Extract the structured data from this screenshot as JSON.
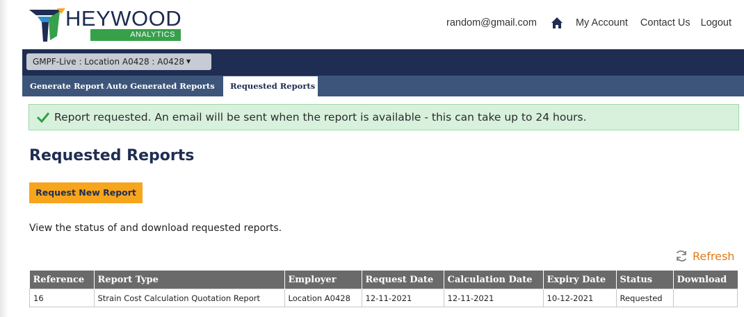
{
  "header": {
    "logo_text": "HEYWOOD",
    "logo_sub": "ANALYTICS",
    "user_email": "random@gmail.com",
    "home_icon": "home-icon",
    "links": [
      "My Account",
      "Contact Us",
      "Logout"
    ]
  },
  "location_selector": {
    "value": "GMPF-Live : Location A0428 : A0428"
  },
  "tabs": [
    {
      "label": "Generate Report",
      "active": false
    },
    {
      "label": "Auto Generated Reports",
      "active": false
    },
    {
      "label": "Requested Reports",
      "active": true
    }
  ],
  "alert": {
    "icon": "check-icon",
    "message": "Report requested. An email will be sent when the report is available - this can take up to 24 hours."
  },
  "page": {
    "title": "Requested Reports",
    "request_button": "Request New Report",
    "description": "View the status of and download requested reports.",
    "refresh_label": "Refresh"
  },
  "table": {
    "columns": [
      "Reference",
      "Report Type",
      "Employer",
      "Request Date",
      "Calculation Date",
      "Expiry Date",
      "Status",
      "Download"
    ],
    "rows": [
      [
        "16",
        "Strain Cost Calculation Quotation Report",
        "Location A0428",
        "12-11-2021",
        "12-11-2021",
        "10-12-2021",
        "Requested",
        ""
      ]
    ]
  },
  "colors": {
    "navy": "#1f2d52",
    "tab_bar": "#3d557a",
    "accent_orange": "#f7a51c",
    "success_green": "#d7f1dc",
    "brand_green": "#36a04a"
  }
}
